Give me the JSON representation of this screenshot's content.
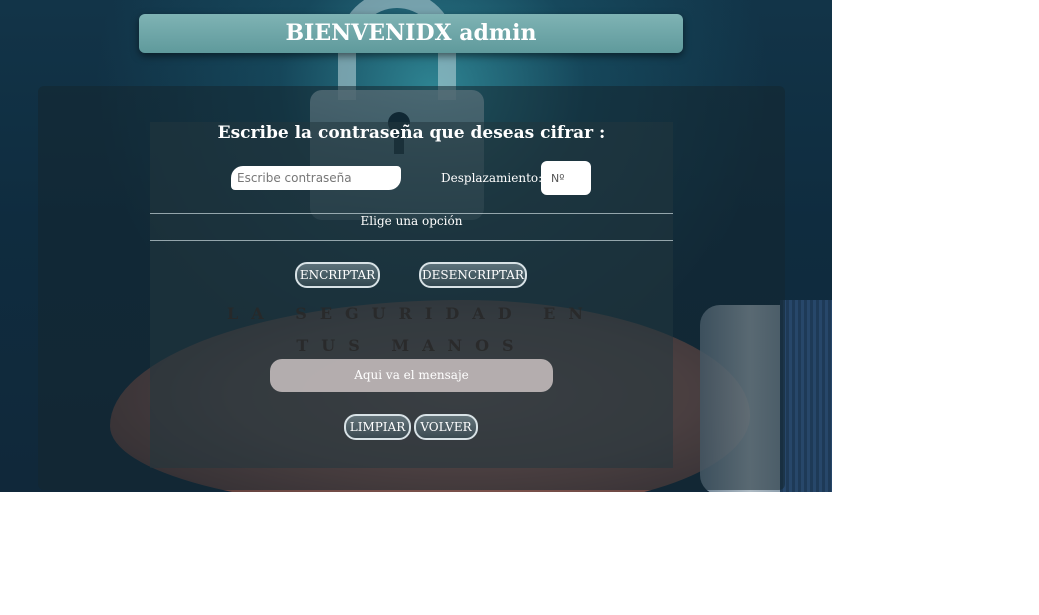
{
  "header": {
    "welcome": "BIENVENIDX admin"
  },
  "form": {
    "heading": "Escribe la contraseña que deseas cifrar :",
    "password_placeholder": "Escribe contraseña",
    "shift_label": "Desplazamiento:",
    "shift_placeholder": "Nº",
    "option_label": "Elige una opción"
  },
  "actions": {
    "encrypt": "ENCRIPTAR",
    "decrypt": "DESENCRIPTAR",
    "clear": "LIMPIAR",
    "back": "VOLVER"
  },
  "slogan": {
    "line1": "LA SEGURIDAD EN",
    "line2": "TUS MANOS"
  },
  "message": {
    "placeholder": "Aqui va el mensaje"
  }
}
